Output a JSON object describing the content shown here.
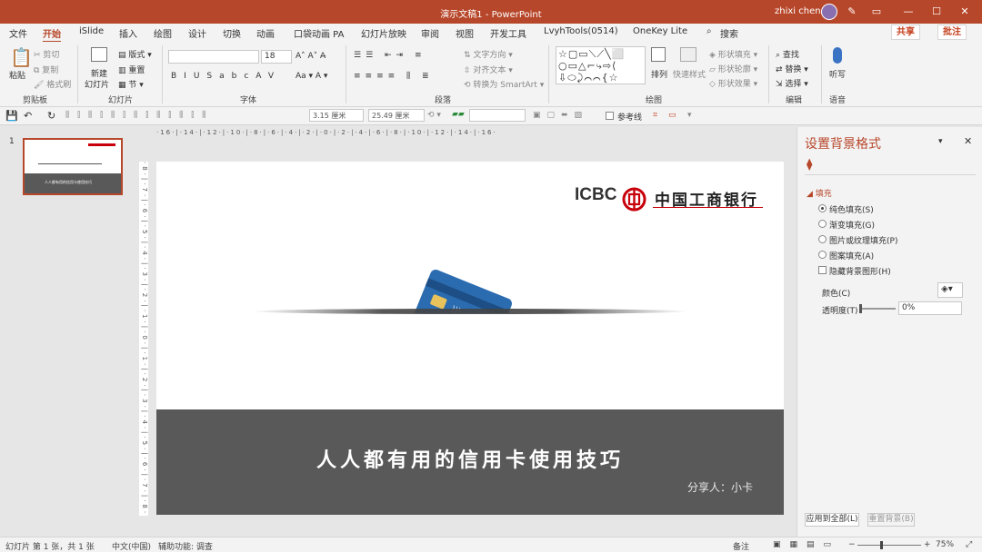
{
  "titlebar": {
    "title": "演示文稿1  -  PowerPoint",
    "user": "zhixi chen",
    "min": "—",
    "restore": "☐",
    "close": "✕"
  },
  "menu": [
    "文件",
    "开始",
    "iSlide",
    "插入",
    "绘图",
    "设计",
    "切换",
    "动画",
    "口袋动画 PA",
    "幻灯片放映",
    "审阅",
    "视图",
    "开发工具",
    "LvyhTools(0514)",
    "OneKey Lite"
  ],
  "search": "搜索",
  "share": "共享",
  "comment": "批注",
  "ribbon": {
    "paste": "粘贴",
    "cut": "剪切",
    "copy": "复制",
    "format_painter": "格式刷",
    "group_clipboard": "剪贴板",
    "new_slide_1": "新建",
    "new_slide_2": "幻灯片",
    "layout": "版式",
    "reset": "重置",
    "section": "节",
    "group_slides": "幻灯片",
    "font_size": "18",
    "group_font": "字体",
    "text_direction": "文字方向",
    "align_text": "对齐文本",
    "convert_smartart": "转换为 SmartArt",
    "group_paragraph": "段落",
    "arrange": "排列",
    "quick_styles": "快速样式",
    "shape_fill": "形状填充",
    "shape_outline": "形状轮廓",
    "shape_effects": "形状效果",
    "group_drawing": "绘图",
    "find": "查找",
    "replace": "替换",
    "select": "选择",
    "group_editing": "编辑",
    "dictate": "听写",
    "group_voice": "语音"
  },
  "qat": {
    "width": "3.15 厘米",
    "height": "25.49 厘米",
    "guides": "参考线"
  },
  "thumb": {
    "number": "1",
    "title": "人人都有用的信用卡使用技巧"
  },
  "ruler_h": "·16·|·14·|·12·|·10·|·8·|·6·|·4·|·2·|·0·|·2·|·4·|·6·|·8·|·10·|·12·|·14·|·16·",
  "ruler_v": "·8·|·7·|·6·|·5·|·4·|·3·|·2·|·1·|·0·|·1·|·2·|·3·|·4·|·5·|·6·|·7·|·8·|·9·",
  "slide": {
    "logo_latin": "ICBC",
    "logo_cn": "中国工商银行",
    "title": "人人都有用的信用卡使用技巧",
    "presenter": "分享人：小卡"
  },
  "pane": {
    "title": "设置背景格式",
    "section": "填充",
    "options": [
      "纯色填充(S)",
      "渐变填充(G)",
      "图片或纹理填充(P)",
      "图案填充(A)"
    ],
    "hide_bg": "隐藏背景图形(H)",
    "color_label": "颜色(C)",
    "transparency_label": "透明度(T)",
    "transparency_value": "0%",
    "apply_all": "应用到全部(L)",
    "reset_bg": "重置背景(B)"
  },
  "status": {
    "slide_info": "幻灯片 第 1 张，共 1 张",
    "language": "中文(中国)",
    "accessibility": "辅助功能: 调查",
    "notes": "备注",
    "zoom": "75%"
  },
  "colors": {
    "accent": "#b7472a",
    "icbc_red": "#c7000b",
    "band": "#595959",
    "card": "#2b6cb0"
  }
}
